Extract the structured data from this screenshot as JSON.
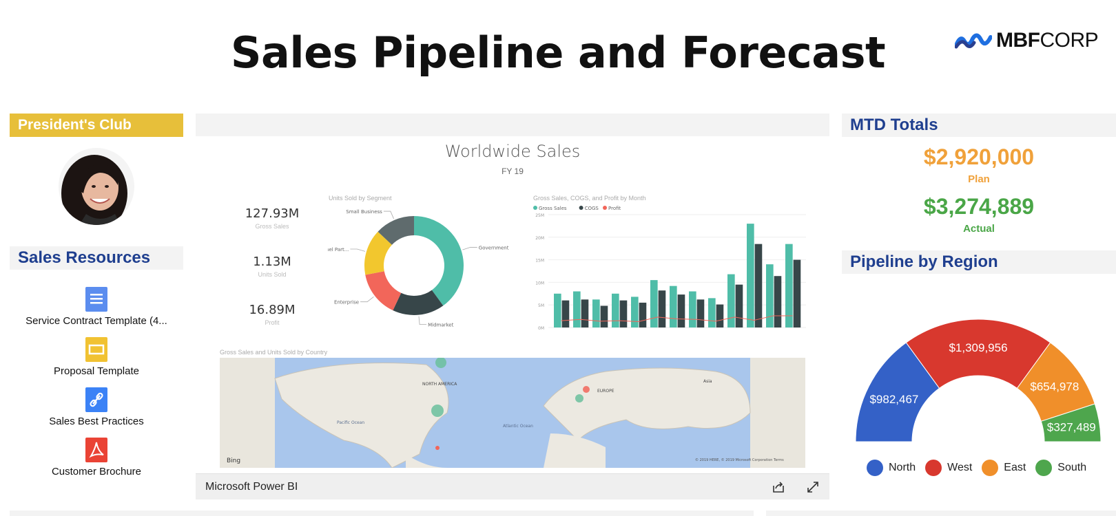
{
  "page": {
    "title": "Sales Pipeline and Forecast"
  },
  "logo": {
    "bold_text": "MBF",
    "light_text": "CORP",
    "icon": "mbf-wave-logo",
    "colors": [
      "#1f6fe0",
      "#2a3f8f"
    ]
  },
  "presidents_club": {
    "label": "President's Club",
    "color": "#e7bf3a"
  },
  "sales_resources": {
    "title": "Sales Resources",
    "items": [
      {
        "label": "Service Contract Template (4...",
        "icon": "document-icon",
        "color": "#5b8def"
      },
      {
        "label": "Proposal Template",
        "icon": "slides-icon",
        "color": "#f1c232"
      },
      {
        "label": "Sales Best Practices",
        "icon": "link-icon",
        "color": "#3b82f6"
      },
      {
        "label": "Customer Brochure",
        "icon": "pdf-icon",
        "color": "#ea4335"
      }
    ]
  },
  "powerbi": {
    "title": "Worldwide Sales",
    "subtitle": "FY 19",
    "kpis": [
      {
        "value": "127.93M",
        "label": "Gross Sales"
      },
      {
        "value": "1.13M",
        "label": "Units Sold"
      },
      {
        "value": "16.89M",
        "label": "Profit"
      }
    ],
    "donut_title": "Units Sold by Segment",
    "bar_title": "Gross Sales, COGS, and Profit by Month",
    "map_title": "Gross Sales and Units Sold by Country",
    "footer_brand": "Microsoft Power BI",
    "map_labels": {
      "north_america": "NORTH AMERICA",
      "europe": "EUROPE",
      "asia": "Asia",
      "pacific": "Pacific Ocean",
      "atlantic": "Atlantic Ocean",
      "bing": "Bing",
      "copyright": "© 2019 HERE, © 2019 Microsoft Corporation  Terms"
    }
  },
  "chart_data": [
    {
      "type": "pie",
      "title": "Units Sold by Segment",
      "categories": [
        "Government",
        "Midmarket",
        "Enterprise",
        "Channel Part...",
        "Small Business"
      ],
      "values": [
        40,
        17,
        15,
        15,
        13
      ],
      "colors": [
        "#4fbda8",
        "#374649",
        "#f2665a",
        "#f2c72e",
        "#5f6b6d"
      ]
    },
    {
      "type": "bar",
      "title": "Gross Sales, COGS, and Profit by Month",
      "ylim": [
        0,
        25
      ],
      "yticks": [
        "0M",
        "5M",
        "10M",
        "15M",
        "20M",
        "25M"
      ],
      "categories": [
        "1",
        "2",
        "3",
        "4",
        "5",
        "6",
        "7",
        "8",
        "9",
        "10",
        "11",
        "12"
      ],
      "series": [
        {
          "name": "Gross Sales",
          "color": "#4fbda8",
          "values": [
            7.5,
            8,
            6.2,
            7.5,
            6.8,
            10.5,
            9.2,
            8,
            6.5,
            11.8,
            23,
            14
          ]
        },
        {
          "name": "COGS",
          "color": "#374649",
          "values": [
            6,
            6.2,
            4.8,
            6,
            5.5,
            8.2,
            7.3,
            6.2,
            5.1,
            9.5,
            18.5,
            11.4
          ],
          "type": "bar"
        },
        {
          "name": "Profit",
          "color": "#f2665a",
          "values": [
            1.5,
            1.8,
            1.4,
            1.5,
            1.3,
            2.3,
            1.9,
            1.8,
            1.4,
            2.3,
            1.6,
            2.6
          ],
          "type": "line"
        }
      ],
      "extra_bars": {
        "gross": [
          18.5
        ],
        "cogs": [
          15
        ]
      }
    },
    {
      "type": "pie",
      "title": "Pipeline by Region",
      "categories": [
        "North",
        "West",
        "East",
        "South"
      ],
      "values": [
        982467,
        1309956,
        654978,
        327489
      ],
      "labels": [
        "$982,467",
        "$1,309,956",
        "$654,978",
        "$327,489"
      ],
      "colors": [
        "#3461c7",
        "#d8382e",
        "#f08f2a",
        "#4ea64d"
      ]
    }
  ],
  "mtd": {
    "title": "MTD Totals",
    "plan_value": "$2,920,000",
    "plan_label": "Plan",
    "actual_value": "$3,274,889",
    "actual_label": "Actual",
    "plan_color": "#f0a13a",
    "actual_color": "#4aa647"
  },
  "pipeline": {
    "title": "Pipeline by Region"
  }
}
